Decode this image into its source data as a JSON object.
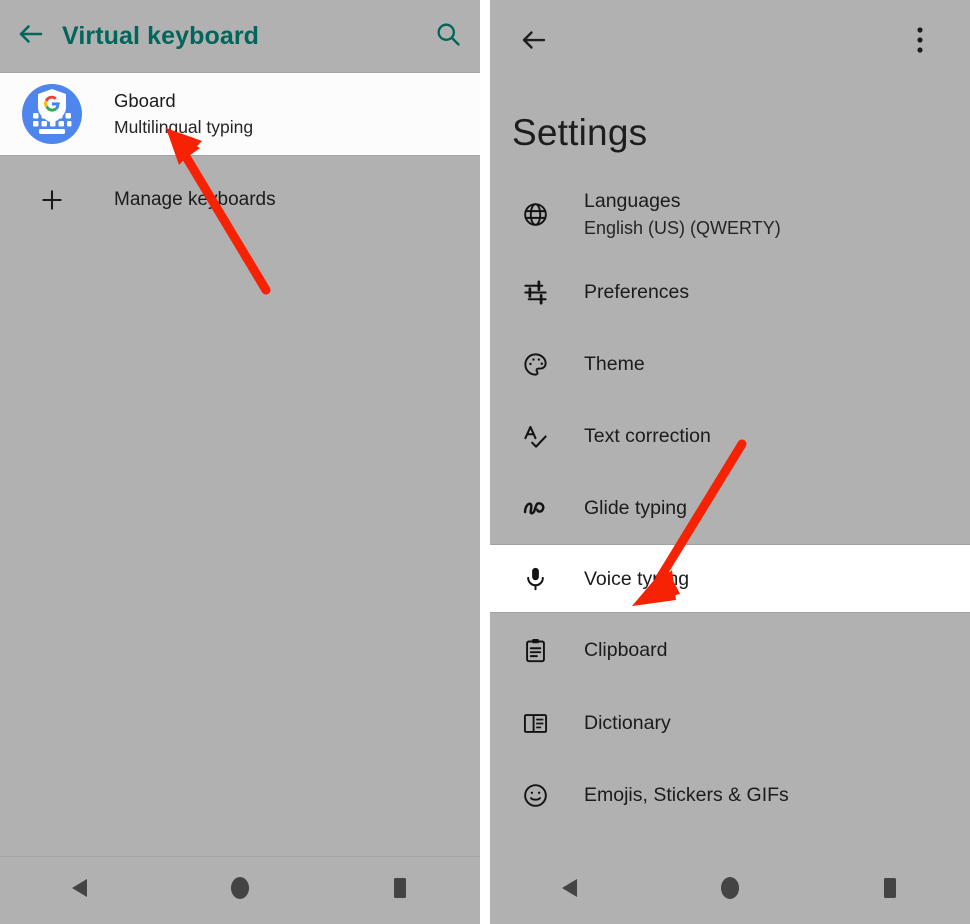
{
  "left_panel": {
    "appbar": {
      "back_icon": "arrow-left-icon",
      "title": "Virtual keyboard",
      "search_icon": "search-icon",
      "accent_color": "#00655a"
    },
    "rows": [
      {
        "icon": "gboard-app-icon",
        "title": "Gboard",
        "subtitle": "Multilingual typing",
        "highlighted": true
      },
      {
        "icon": "plus-icon",
        "title": "Manage keyboards",
        "subtitle": "",
        "highlighted": false
      }
    ]
  },
  "right_panel": {
    "appbar": {
      "back_icon": "arrow-left-icon",
      "overflow_icon": "more-vertical-icon"
    },
    "heading": "Settings",
    "items": [
      {
        "icon": "globe-icon",
        "label": "Languages",
        "subtitle": "English (US) (QWERTY)",
        "highlighted": false
      },
      {
        "icon": "tune-icon",
        "label": "Preferences",
        "subtitle": "",
        "highlighted": false
      },
      {
        "icon": "palette-icon",
        "label": "Theme",
        "subtitle": "",
        "highlighted": false
      },
      {
        "icon": "spellcheck-icon",
        "label": "Text correction",
        "subtitle": "",
        "highlighted": false
      },
      {
        "icon": "glide-icon",
        "label": "Glide typing",
        "subtitle": "",
        "highlighted": false
      },
      {
        "icon": "microphone-icon",
        "label": "Voice typing",
        "subtitle": "",
        "highlighted": true
      },
      {
        "icon": "clipboard-icon",
        "label": "Clipboard",
        "subtitle": "",
        "highlighted": false
      },
      {
        "icon": "dictionary-icon",
        "label": "Dictionary",
        "subtitle": "",
        "highlighted": false
      },
      {
        "icon": "emoji-icon",
        "label": "Emojis, Stickers & GIFs",
        "subtitle": "",
        "highlighted": false
      }
    ]
  },
  "navbar": {
    "back_label": "Back",
    "home_label": "Home",
    "recents_label": "Recent apps"
  },
  "annotations": {
    "arrow_color": "#f72103",
    "left_arrow_target": "Gboard row",
    "right_arrow_target": "Voice typing row"
  },
  "colors": {
    "background_gray": "#b1b1b1",
    "highlight_white": "#ffffff",
    "accent_teal": "#00655a",
    "text_dark": "#1b1b1b"
  }
}
